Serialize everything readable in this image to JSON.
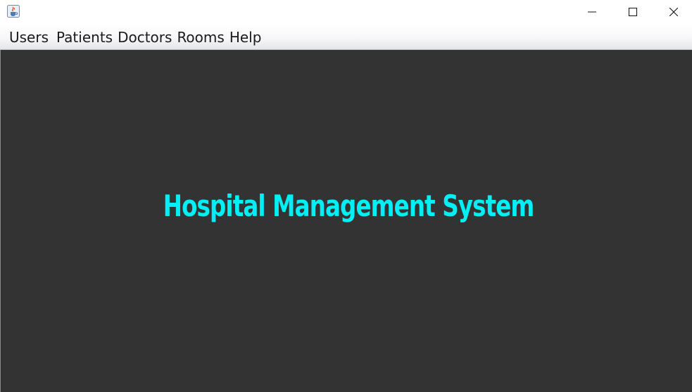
{
  "window": {
    "icon": "java-coffee-cup-icon",
    "controls": [
      "minimize-icon",
      "maximize-icon",
      "close-icon"
    ]
  },
  "menubar": {
    "items": [
      {
        "label": "Users"
      },
      {
        "label": "Patients"
      },
      {
        "label": "Doctors"
      },
      {
        "label": "Rooms"
      },
      {
        "label": "Help"
      }
    ]
  },
  "main": {
    "title": "Hospital Management System"
  },
  "colors": {
    "background": "#333333",
    "title": "#00f0f5",
    "menubar": "#f2f2f4"
  }
}
